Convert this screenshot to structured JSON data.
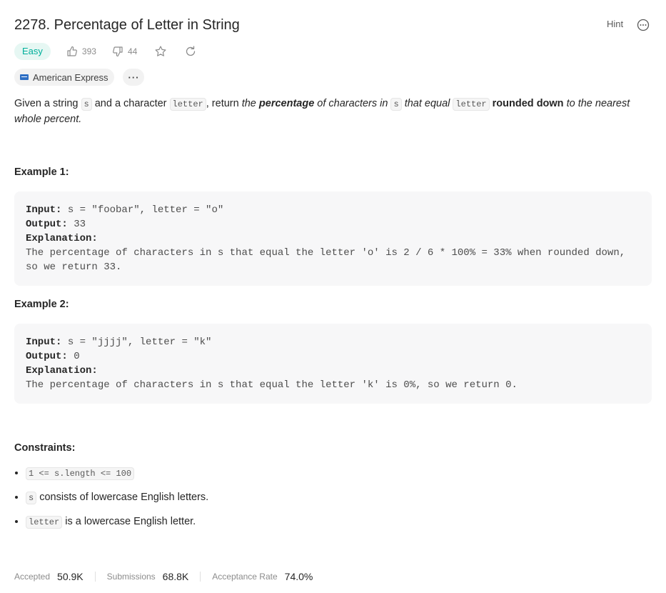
{
  "problem": {
    "title": "2278. Percentage of Letter in String",
    "hint_label": "Hint",
    "difficulty": "Easy",
    "likes": "393",
    "dislikes": "44",
    "company": "American Express",
    "more_tags": "···"
  },
  "description": {
    "p1": "Given a string ",
    "code_s": "s",
    "p2": " and a character ",
    "code_letter": "letter",
    "p3": ", return ",
    "i1": "the ",
    "b1": "percentage",
    "i2": " of characters in ",
    "code_s2": "s",
    "i3": " that equal ",
    "code_letter2": "letter",
    "b2": " rounded down",
    "i4": " to the nearest whole percent."
  },
  "examples": [
    {
      "title": "Example 1:",
      "input_label": "Input:",
      "input": " s = \"foobar\", letter = \"o\"",
      "output_label": "Output:",
      "output": " 33",
      "explanation_label": "Explanation:",
      "explanation": "The percentage of characters in s that equal the letter 'o' is 2 / 6 * 100% = 33% when rounded down, so we return 33."
    },
    {
      "title": "Example 2:",
      "input_label": "Input:",
      "input": " s = \"jjjj\", letter = \"k\"",
      "output_label": "Output:",
      "output": " 0",
      "explanation_label": "Explanation:",
      "explanation": "The percentage of characters in s that equal the letter 'k' is 0%, so we return 0."
    }
  ],
  "constraints": {
    "title": "Constraints:",
    "c1_code": "1 <= s.length <= 100",
    "c2_code": "s",
    "c2_text": " consists of lowercase English letters.",
    "c3_code": "letter",
    "c3_text": " is a lowercase English letter."
  },
  "stats": {
    "accepted_label": "Accepted",
    "accepted": "50.9K",
    "submissions_label": "Submissions",
    "submissions": "68.8K",
    "rate_label": "Acceptance Rate",
    "rate": "74.0%"
  },
  "colors": {
    "easy": "#00af9b",
    "easy_bg": "#e6f7f3",
    "amex": "#2e6fc4"
  },
  "icons": [
    "thumbs-up-icon",
    "thumbs-down-icon",
    "star-icon",
    "refresh-icon",
    "more-horizontal-icon"
  ]
}
